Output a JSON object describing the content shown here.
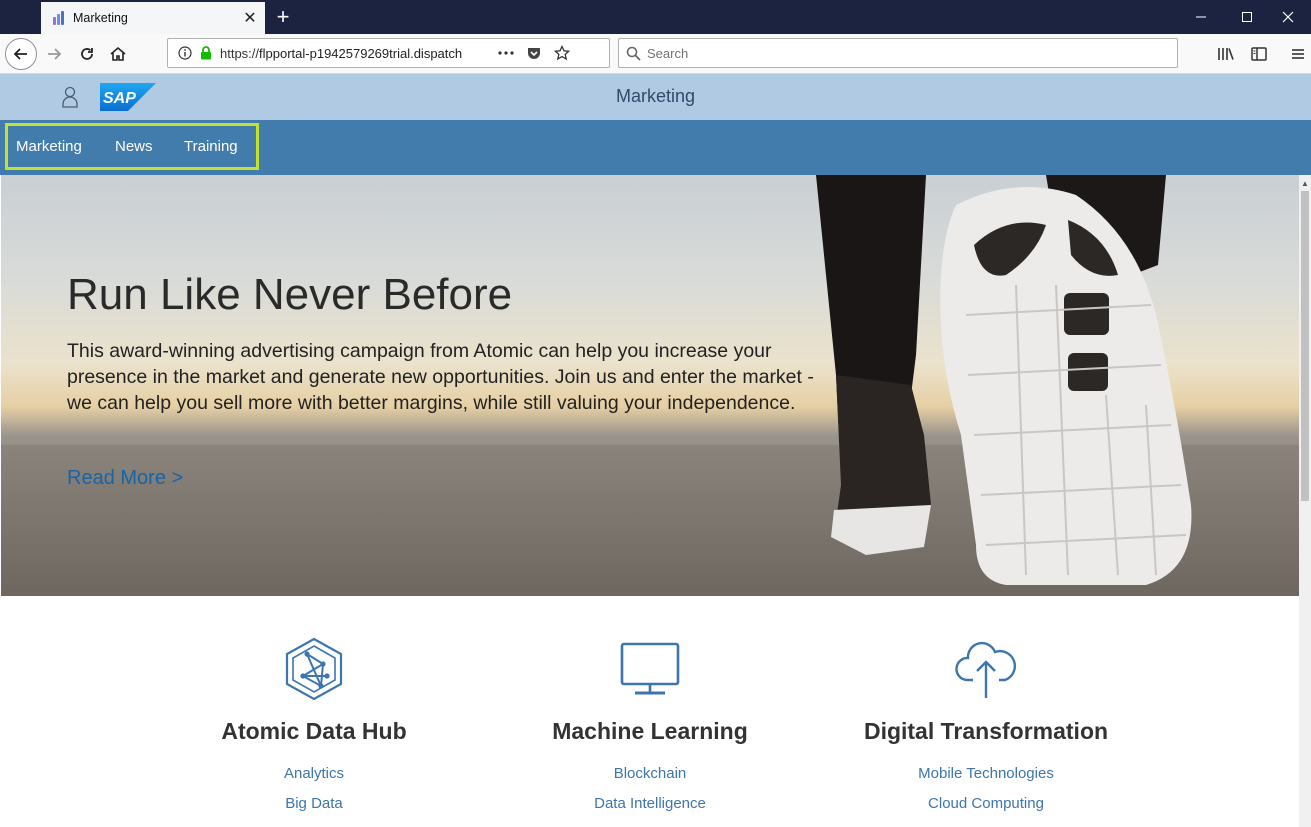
{
  "browser": {
    "tab_title": "Marketing",
    "url_scheme": "https://",
    "url_host": "flpportal-p1942579269trial.dispatch",
    "search_placeholder": "Search"
  },
  "shell": {
    "title": "Marketing",
    "logo_text": "SAP"
  },
  "menu": {
    "items": [
      {
        "label": "Marketing"
      },
      {
        "label": "News"
      },
      {
        "label": "Training"
      }
    ],
    "highlight_color": "#c4e12f"
  },
  "hero": {
    "title": "Run Like Never Before",
    "text": "This award-winning advertising campaign from Atomic can help you increase your presence in the market and generate new opportunities. Join us and enter the market - we can help you sell more with better margins, while still valuing your independence.",
    "link": "Read More >"
  },
  "features": [
    {
      "title": "Atomic Data Hub",
      "icon": "network-icon",
      "links": [
        "Analytics",
        "Big Data"
      ]
    },
    {
      "title": "Machine Learning",
      "icon": "monitor-icon",
      "links": [
        "Blockchain",
        "Data Intelligence"
      ]
    },
    {
      "title": "Digital Transformation",
      "icon": "cloud-upload-icon",
      "links": [
        "Mobile Technologies",
        "Cloud Computing"
      ]
    }
  ],
  "colors": {
    "shell_bar": "#b0cae4",
    "menu_bar": "#427cac",
    "link": "#3d75ad",
    "titlebar": "#1c2341"
  }
}
